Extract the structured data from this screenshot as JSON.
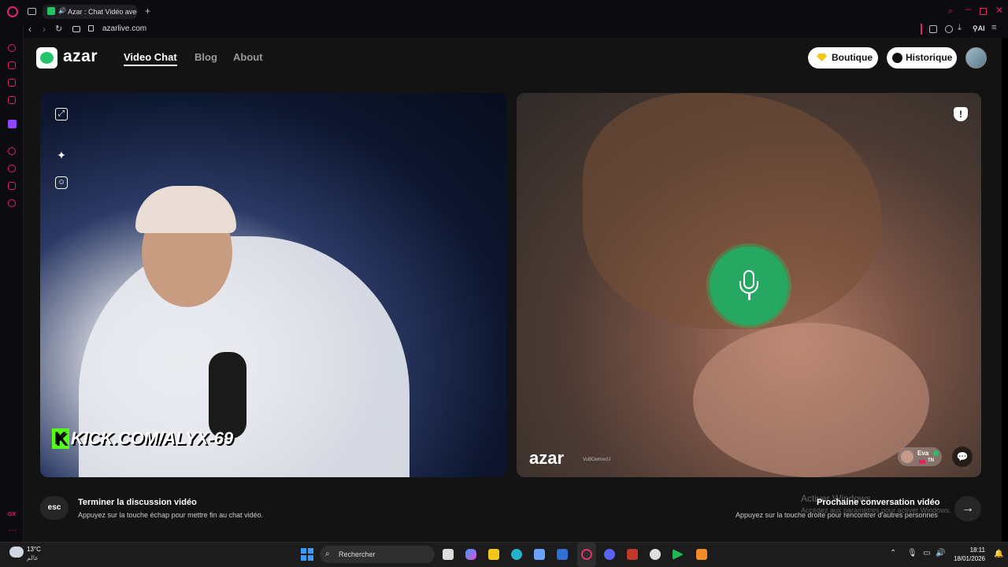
{
  "browser": {
    "tab_title": "Azar : Chat Vidéo avec",
    "url": "azarlive.com",
    "ai_label": "AI"
  },
  "site": {
    "logo": "azar",
    "nav": [
      "Video Chat",
      "Blog",
      "About"
    ],
    "boutique": "Boutique",
    "historique": "Historique"
  },
  "left_video": {
    "overlay_text": "KICK.COM/ALYX-69",
    "kick_k": "K"
  },
  "right_video": {
    "watermark": "azar",
    "watermark_id": "VuBOwmxcU",
    "user_name": "Eva",
    "user_country": "TN"
  },
  "footer": {
    "esc_label": "esc",
    "end_title": "Terminer la discussion vidéo",
    "end_sub": "Appuyez sur la touche échap pour mettre fin au chat vidéo.",
    "next_title": "Prochaine conversation vidéo",
    "next_sub": "Appuyez sur la touche droite pour rencontrer d'autres personnes",
    "activate_title": "Activer Windows",
    "activate_sub": "Accédez aux paramètres pour activer Windows."
  },
  "taskbar": {
    "temp": "13°C",
    "weather": "عالم",
    "search": "Rechercher",
    "time": "18:11",
    "date": "18/01/2026"
  },
  "colors": {
    "accent": "#22c55e",
    "opera": "#e0245e",
    "kick": "#53fc18"
  }
}
